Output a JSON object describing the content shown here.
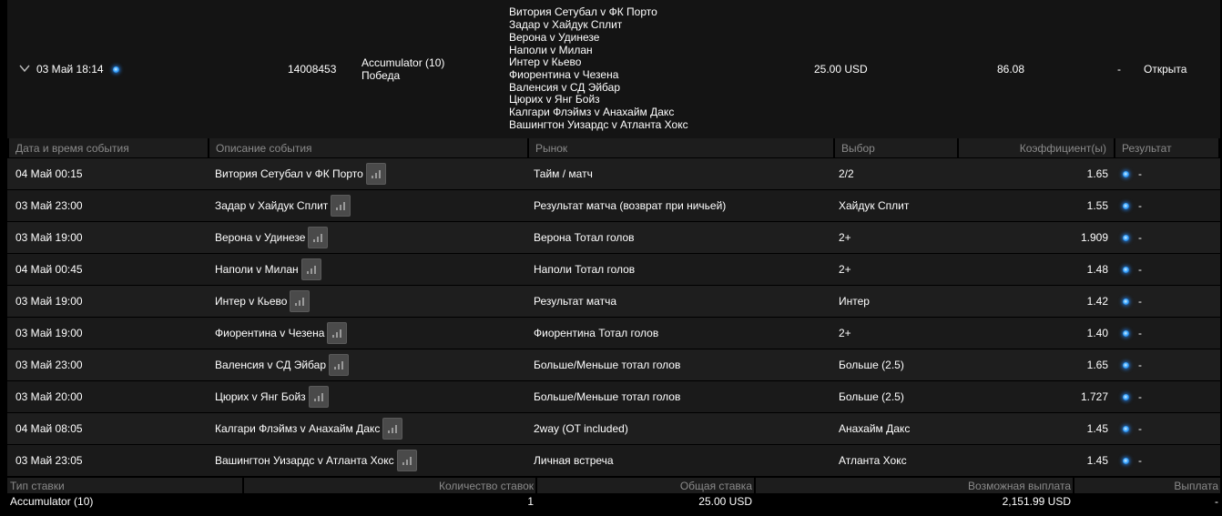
{
  "summary": {
    "datetime": "03 Май 18:14",
    "bet_id": "14008453",
    "bet_type": "Accumulator (10)",
    "bet_result": "Победа",
    "events": [
      "Витория Сетубал v ФК Порто",
      "Задар v Хайдук Сплит",
      "Верона v Удинезе",
      "Наполи v Милан",
      "Интер v Кьево",
      "Фиорентина v Чезена",
      "Валенсия v СД Эйбар",
      "Цюрих v Янг Бойз",
      "Калгари Флэймз v Анахайм Дакс",
      "Вашингтон Уизардс v Атланта Хокс"
    ],
    "stake": "25.00 USD",
    "odds": "86.08",
    "dash": "-",
    "status": "Открыта"
  },
  "events_table": {
    "headers": {
      "datetime": "Дата и время события",
      "description": "Описание события",
      "market": "Рынок",
      "selection": "Выбор",
      "odds": "Коэффициент(ы)",
      "result": "Результат"
    },
    "rows": [
      {
        "datetime": "04 Май 00:15",
        "description": "Витория Сетубал v ФК Порто",
        "market": "Тайм / матч",
        "selection": "2/2",
        "odds": "1.65",
        "result": "-"
      },
      {
        "datetime": "03 Май 23:00",
        "description": "Задар v Хайдук Сплит",
        "market": "Результат матча (возврат при ничьей)",
        "selection": "Хайдук Сплит",
        "odds": "1.55",
        "result": "-"
      },
      {
        "datetime": "03 Май 19:00",
        "description": "Верона v Удинезе",
        "market": "Верона Тотал голов",
        "selection": "2+",
        "odds": "1.909",
        "result": "-"
      },
      {
        "datetime": "04 Май 00:45",
        "description": "Наполи v Милан",
        "market": "Наполи Тотал голов",
        "selection": "2+",
        "odds": "1.48",
        "result": "-"
      },
      {
        "datetime": "03 Май 19:00",
        "description": "Интер v Кьево",
        "market": "Результат матча",
        "selection": "Интер",
        "odds": "1.42",
        "result": "-"
      },
      {
        "datetime": "03 Май 19:00",
        "description": "Фиорентина v Чезена",
        "market": "Фиорентина Тотал голов",
        "selection": "2+",
        "odds": "1.40",
        "result": "-"
      },
      {
        "datetime": "03 Май 23:00",
        "description": "Валенсия v СД Эйбар",
        "market": "Больше/Меньше тотал голов",
        "selection": "Больше (2.5)",
        "odds": "1.65",
        "result": "-"
      },
      {
        "datetime": "03 Май 20:00",
        "description": "Цюрих v Янг Бойз",
        "market": "Больше/Меньше тотал голов",
        "selection": "Больше (2.5)",
        "odds": "1.727",
        "result": "-"
      },
      {
        "datetime": "04 Май 08:05",
        "description": "Калгари Флэймз v Анахайм Дакс",
        "market": "2way (OT included)",
        "selection": "Анахайм Дакс",
        "odds": "1.45",
        "result": "-"
      },
      {
        "datetime": "03 Май 23:05",
        "description": "Вашингтон Уизардс v Атланта Хокс",
        "market": "Личная встреча",
        "selection": "Атланта Хокс",
        "odds": "1.45",
        "result": "-"
      }
    ]
  },
  "footer": {
    "headers": {
      "bet_type": "Тип ставки",
      "count": "Количество ставок",
      "total_stake": "Общая ставка",
      "potential_payout": "Возможная выплата",
      "payout": "Выплата"
    },
    "values": {
      "bet_type": "Accumulator (10)",
      "count": "1",
      "total_stake": "25.00 USD",
      "potential_payout": "2,151.99 USD",
      "payout": "-"
    }
  },
  "icons": {
    "expand": "chevron-down-icon",
    "status_indicator": "blue-dot-icon",
    "stats": "bar-chart-icon"
  },
  "colors": {
    "background": "#000000",
    "row": "#1a1a1a",
    "header_text": "#8a8a8a",
    "indicator": "#3aa6ff"
  }
}
